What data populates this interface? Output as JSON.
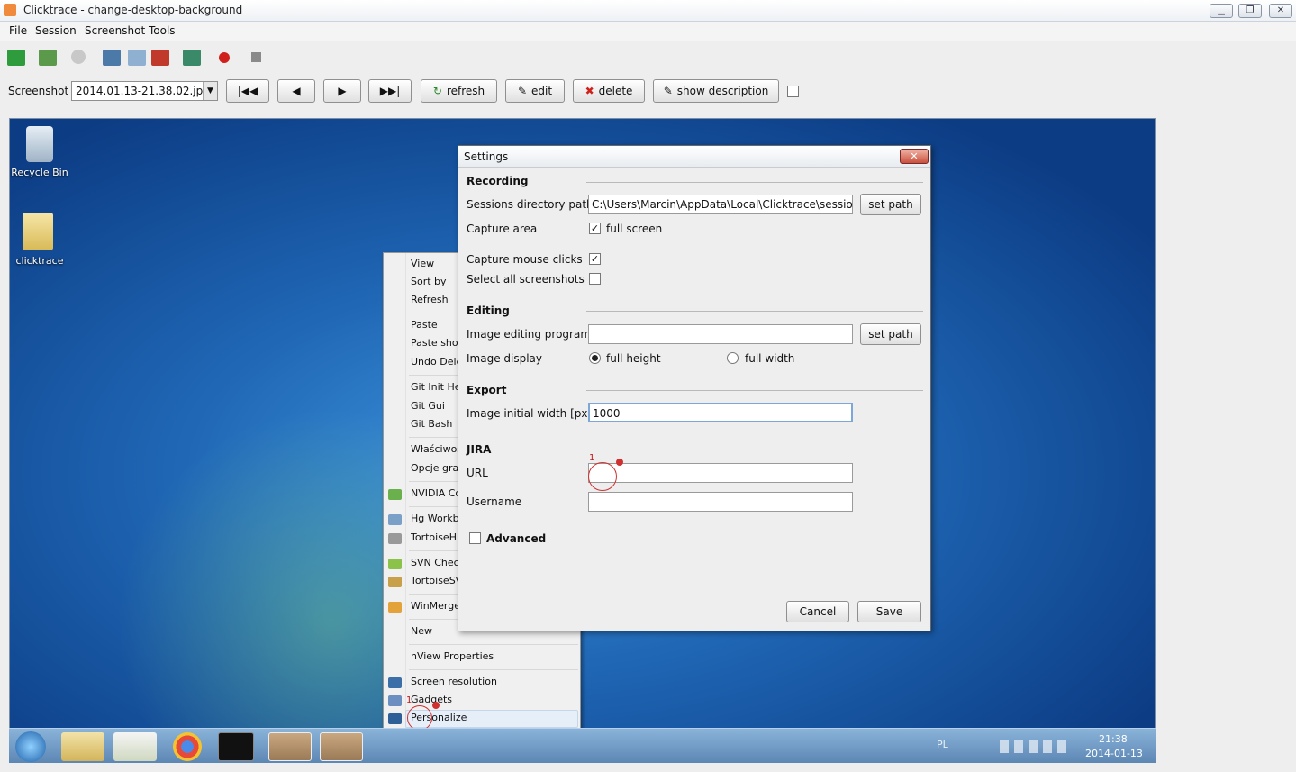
{
  "app": {
    "title": "Clicktrace - change-desktop-background"
  },
  "menubar": [
    "File",
    "Session",
    "Screenshot",
    "Tools"
  ],
  "screenshot_row": {
    "label": "Screenshot",
    "selected_file": "2014.01.13-21.38.02.jpg",
    "refresh": "refresh",
    "edit": "edit",
    "delete": "delete",
    "show_description": "show description"
  },
  "desktop": {
    "icons": [
      "Recycle Bin",
      "clicktrace"
    ],
    "context_menu": [
      "View",
      "Sort by",
      "Refresh",
      "Paste",
      "Paste shor",
      "Undo Dele",
      "Git Init He",
      "Git Gui",
      "Git Bash",
      "Właściwoś",
      "Opcje graf",
      "NVIDIA Co",
      "Hg Workb",
      "TortoiseH",
      "SVN Check",
      "TortoiseSV",
      "WinMerge",
      "New",
      "nView Properties",
      "Screen resolution",
      "Gadgets",
      "Personalize"
    ],
    "click_marker": "1",
    "tray": {
      "lang": "PL",
      "time": "21:38",
      "date": "2014-01-13"
    }
  },
  "dialog": {
    "title": "Settings",
    "recording": {
      "heading": "Recording",
      "sessions_label": "Sessions directory path",
      "sessions_value": "C:\\Users\\Marcin\\AppData\\Local\\Clicktrace\\sessions\\",
      "set_path": "set path",
      "capture_area_label": "Capture area",
      "full_screen": "full screen",
      "capture_clicks_label": "Capture mouse clicks",
      "select_all_label": "Select all screenshots"
    },
    "editing": {
      "heading": "Editing",
      "program_label": "Image editing program",
      "program_value": "",
      "set_path": "set path",
      "display_label": "Image display",
      "full_height": "full height",
      "full_width": "full width"
    },
    "export": {
      "heading": "Export",
      "width_label": "Image initial width [px]",
      "width_value": "1000"
    },
    "jira": {
      "heading": "JIRA",
      "url_label": "URL",
      "url_value": "",
      "username_label": "Username",
      "username_value": "",
      "click_marker": "1"
    },
    "advanced": "Advanced",
    "cancel": "Cancel",
    "save": "Save"
  }
}
